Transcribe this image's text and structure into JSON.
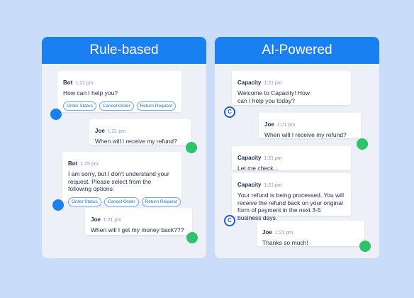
{
  "left": {
    "title": "Rule-based",
    "messages": [
      {
        "name": "Bot",
        "time": "1:21 pm",
        "text": "How can I help you?",
        "options": [
          "Order Status",
          "Cancel Order",
          "Return Request"
        ]
      },
      {
        "name": "Joe",
        "time": "1:21 pm",
        "text": "When will I receive my refund?"
      },
      {
        "name": "Bot",
        "time": "1:25 pm",
        "text": "I am sorry, but I don't understand your request. Please select from the following options:",
        "options": [
          "Order Status",
          "Cancel Order",
          "Return Request"
        ]
      },
      {
        "name": "Joe",
        "time": "1:21 pm",
        "text": "When will I get my money back???"
      }
    ]
  },
  "right": {
    "title": "AI-Powered",
    "avatar_letter": "C",
    "messages": [
      {
        "name": "Capacity",
        "time": "1:21 pm",
        "text": "Welcome to Capacity! How can I help you today?"
      },
      {
        "name": "Joe",
        "time": "1:21 pm",
        "text": "When will I receive my refund?"
      },
      {
        "name": "Capacity",
        "time": "1:21 pm",
        "text": "Let me check..."
      },
      {
        "name": "Capacity",
        "time": "1:21 pm",
        "text": "Your refund is being processed. You will receive the refund back on your original form of payment in the next 3-5 business days."
      },
      {
        "name": "Joe",
        "time": "1:21 pm",
        "text": "Thanks so much!"
      }
    ]
  },
  "colors": {
    "background": "#c9dcfa",
    "header": "#1a7ff0",
    "bot_avatar": "#1a7ff0",
    "user_avatar": "#2cc36b"
  }
}
